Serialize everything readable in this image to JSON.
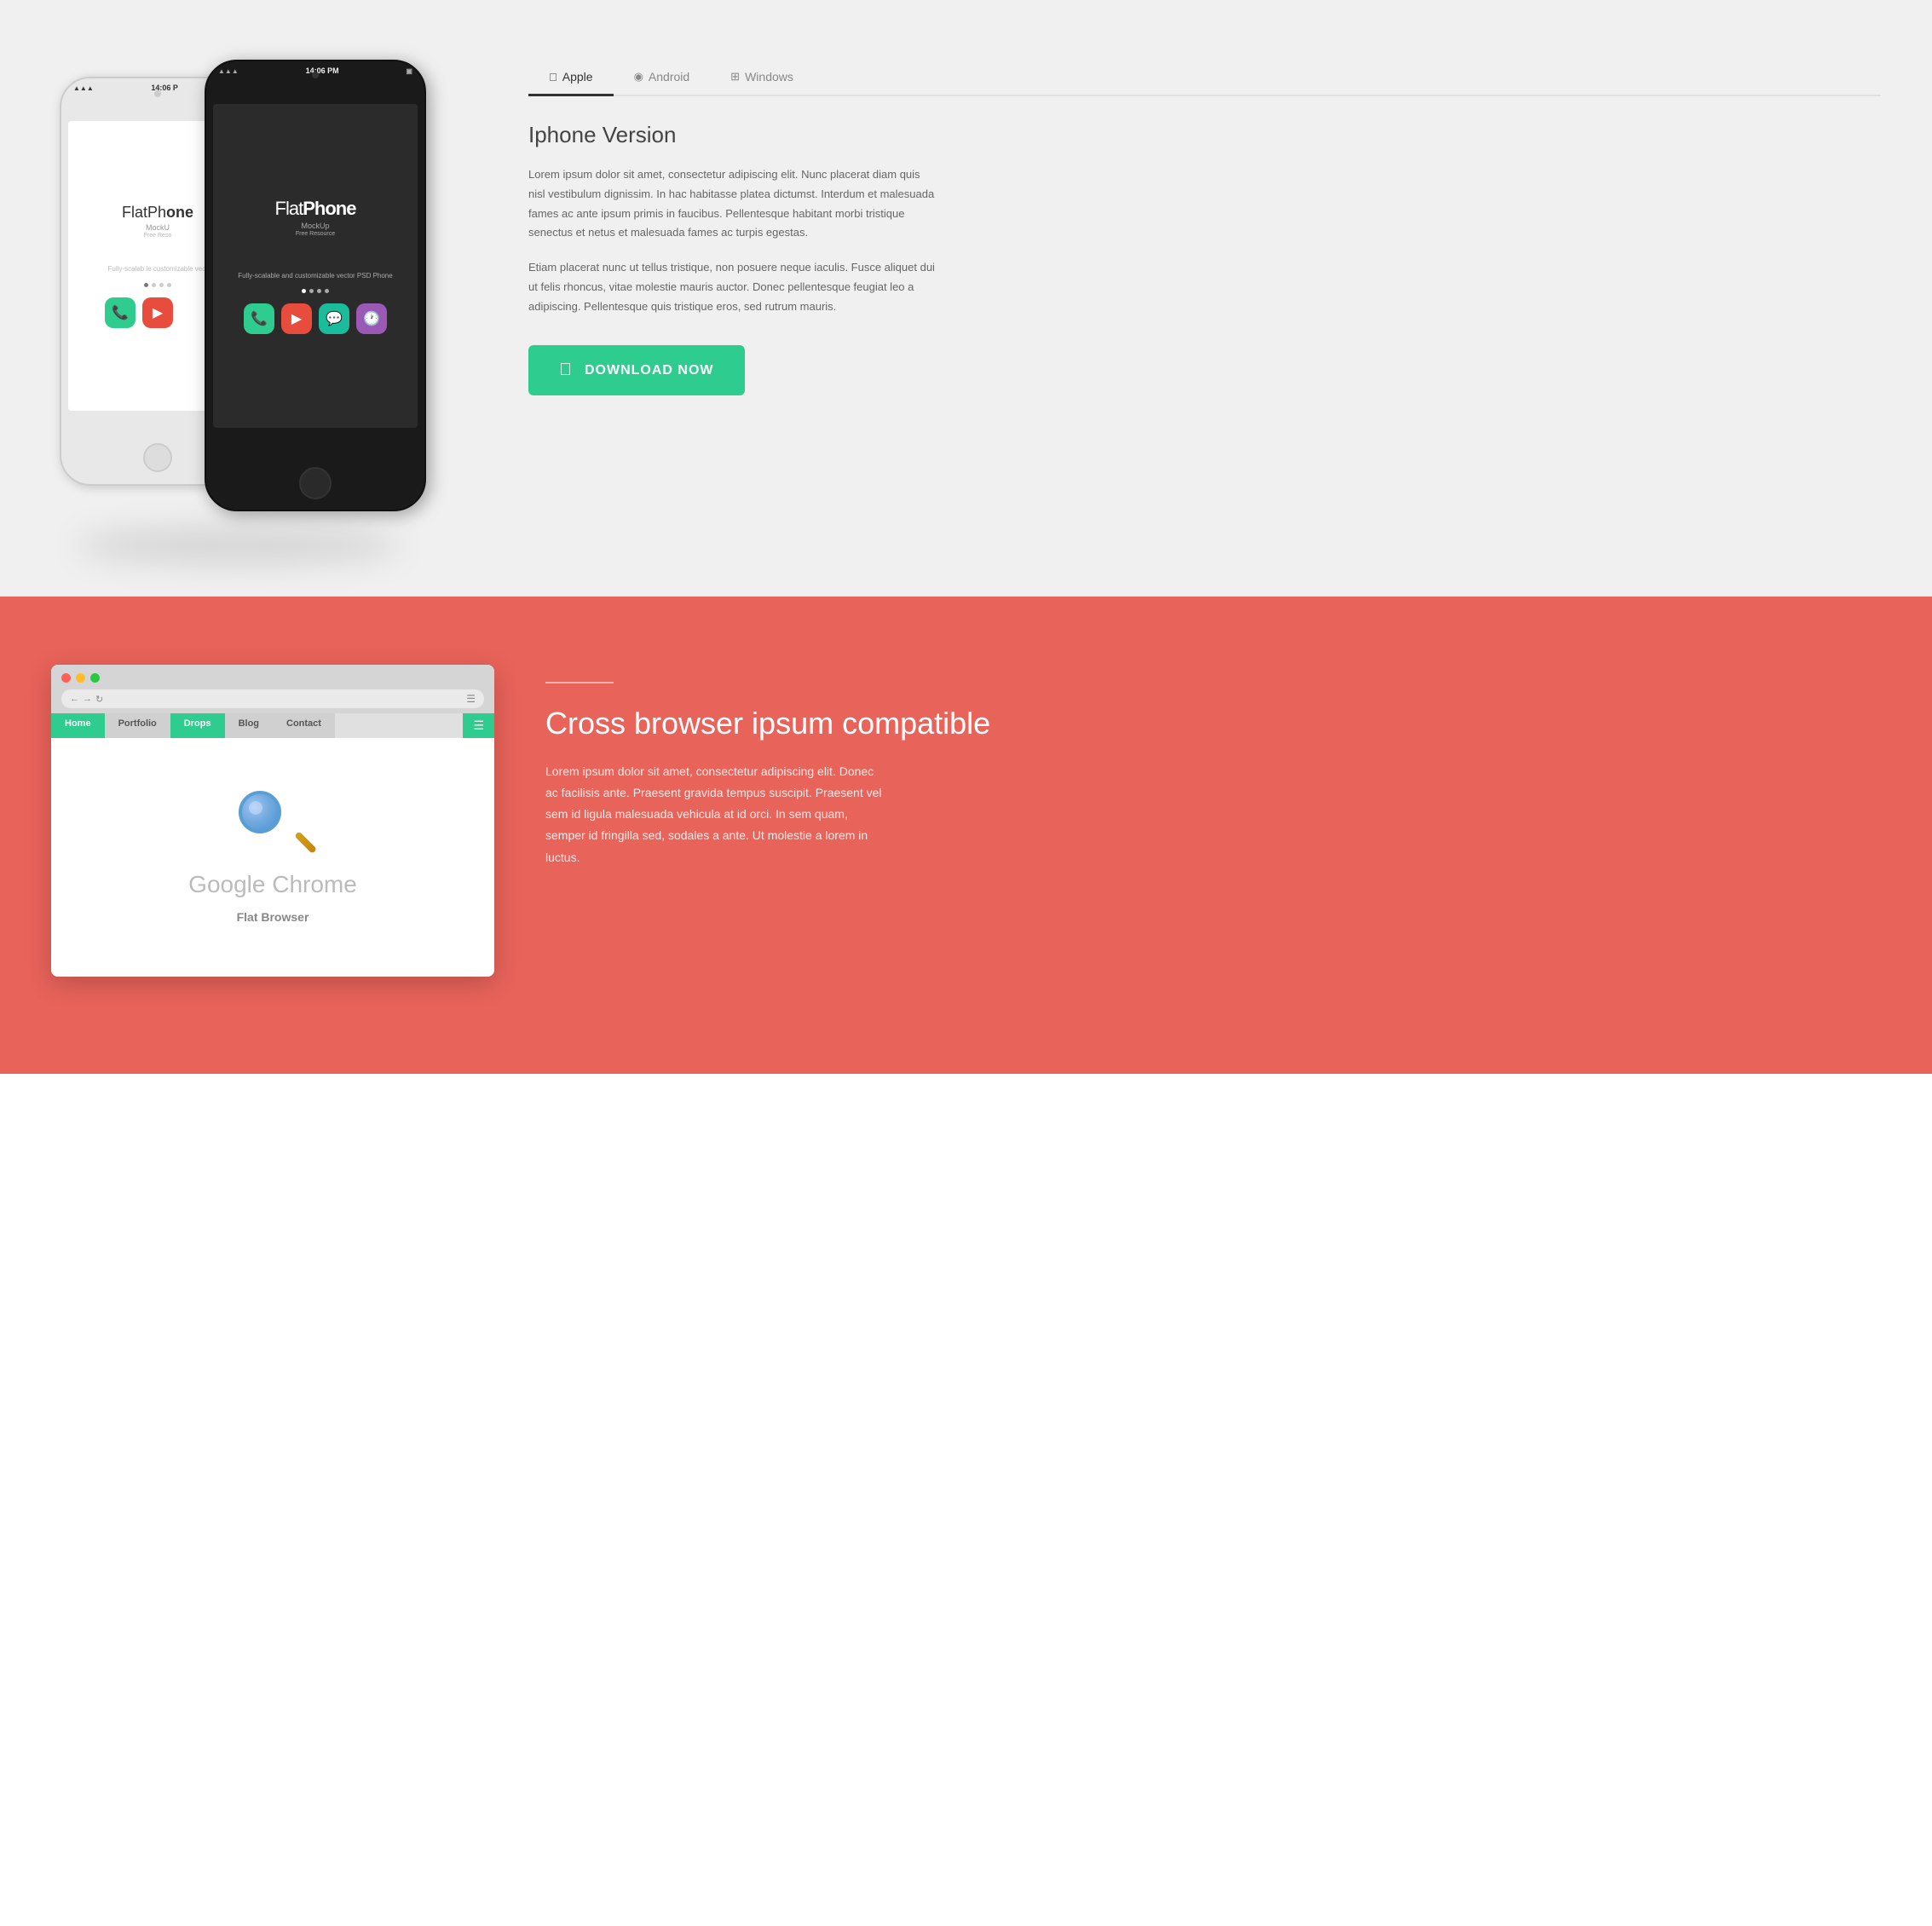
{
  "section_top": {
    "phone_white": {
      "time": "14:06 P",
      "brand_prefix": "FlatPh",
      "mockup_label": "MockU",
      "free_label": "Free Reso",
      "desc": "Fully-scalab le customizable vect",
      "dots": [
        "",
        "",
        "",
        ""
      ]
    },
    "phone_black": {
      "time": "14:06 PM",
      "brand_prefix": "Flat",
      "brand_suffix": "Phone",
      "mockup_label": "MockUp",
      "free_label": "Free Resource",
      "desc": "Fully-scalable and customizable vector PSD Phone",
      "dots": [
        "",
        "",
        "",
        ""
      ]
    },
    "tabs": [
      {
        "id": "apple",
        "label": "Apple",
        "icon": "🍎",
        "active": true
      },
      {
        "id": "android",
        "label": "Android",
        "icon": "📱",
        "active": false
      },
      {
        "id": "windows",
        "label": "Windows",
        "icon": "⊞",
        "active": false
      }
    ],
    "version_title": "Iphone Version",
    "paragraph1": "Lorem ipsum dolor sit amet, consectetur adipiscing elit. Nunc placerat diam quis nisl vestibulum dignissim. In hac habitasse platea dictumst. Interdum et malesuada fames ac ante ipsum primis in faucibus. Pellentesque habitant morbi tristique senectus et netus et malesuada fames ac turpis egestas.",
    "paragraph2": "Etiam placerat nunc ut tellus tristique, non posuere neque iaculis. Fusce aliquet dui ut felis rhoncus, vitae molestie mauris auctor. Donec pellentesque feugiat leo a adipiscing. Pellentesque quis tristique eros, sed rutrum mauris.",
    "download_btn_label": "DOWNLOAD NOW"
  },
  "section_bottom": {
    "browser": {
      "dots": [
        "red",
        "yellow",
        "green"
      ],
      "nav_back": "←",
      "nav_forward": "→",
      "nav_refresh": "↻",
      "address": "",
      "tabs": [
        {
          "label": "Home",
          "active": true
        },
        {
          "label": "Portfolio",
          "active": false
        },
        {
          "label": "Drops",
          "active": true
        },
        {
          "label": "Blog",
          "active": false
        },
        {
          "label": "Contact",
          "active": false
        }
      ],
      "app_title": "Google Chrome",
      "app_subtitle": "Flat Browser"
    },
    "divider": "—",
    "cross_title": "Cross browser ipsum compatible",
    "cross_text": "Lorem ipsum dolor sit amet, consectetur adipiscing elit. Donec ac facilisis ante. Praesent gravida tempus suscipit. Praesent vel sem id ligula malesuada vehicula at id orci. In sem quam, semper id fringilla sed, sodales a ante. Ut molestie a lorem in luctus.",
    "bg_color": "#e8635a"
  },
  "colors": {
    "green_accent": "#2ecc8e",
    "coral": "#e8635a",
    "text_dark": "#444",
    "text_light": "#666"
  }
}
